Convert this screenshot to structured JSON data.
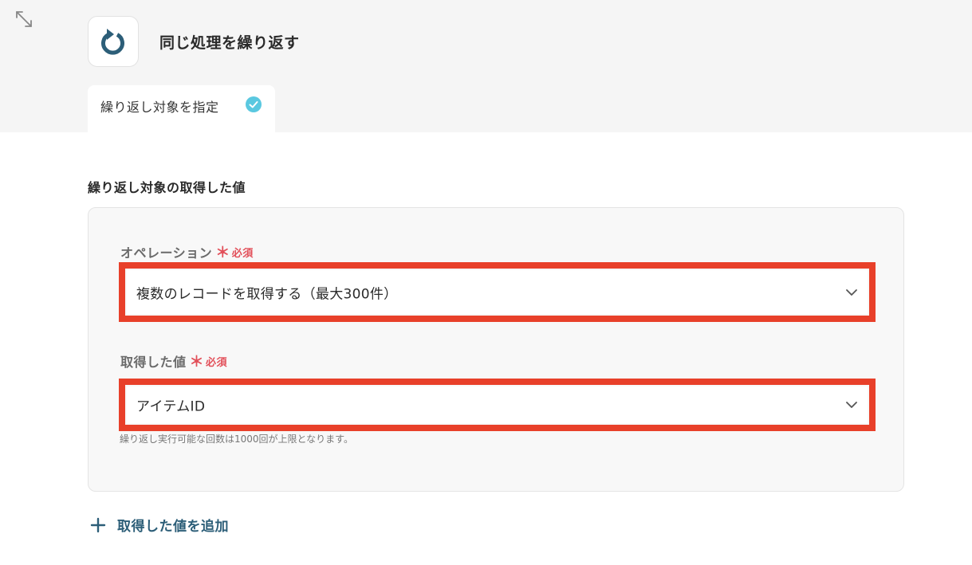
{
  "header": {
    "app_title": "同じ処理を繰り返す",
    "app_icon": "loop-arrow-icon",
    "expand_icon": "expand-arrows-icon"
  },
  "tabs": [
    {
      "label": "繰り返し対象を指定",
      "status_icon": "check-circle-icon",
      "status_color": "#5ac8e0"
    }
  ],
  "section": {
    "title": "繰り返し対象の取得した値"
  },
  "fields": {
    "operation": {
      "label": "オペレーション",
      "required_mark": "＊",
      "required_text": "必須",
      "value": "複数のレコードを取得する（最大300件）"
    },
    "acquired_value": {
      "label": "取得した値",
      "required_mark": "＊",
      "required_text": "必須",
      "value": "アイテムID"
    }
  },
  "hint": "繰り返し実行可能な回数は1000回が上限となります。",
  "add_button": {
    "label": "取得した値を追加"
  },
  "colors": {
    "highlight": "#e8402a",
    "accent": "#2c5e78",
    "required": "#e2505a"
  }
}
